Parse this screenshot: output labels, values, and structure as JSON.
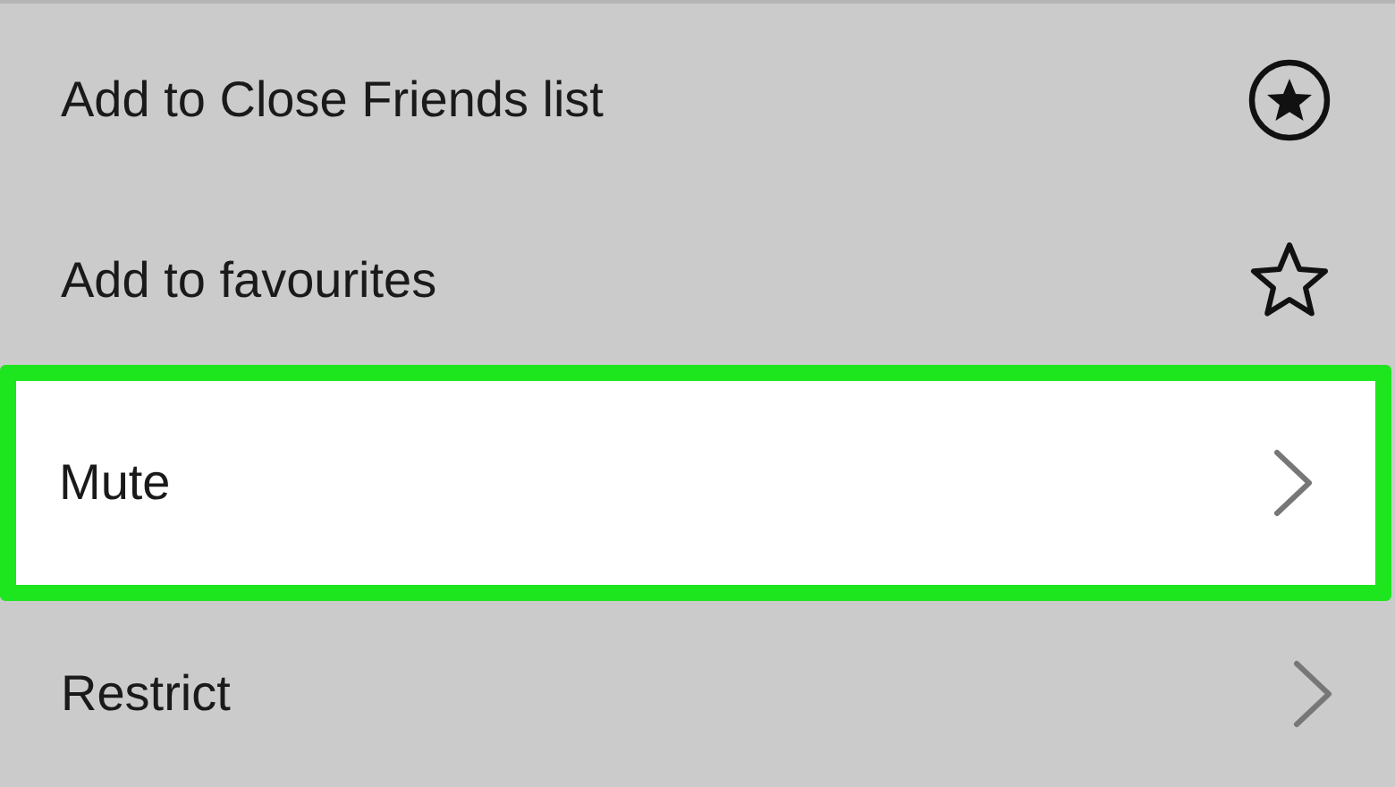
{
  "menu": {
    "items": [
      {
        "label": "Add to Close Friends list",
        "kind": "star-circle",
        "selected": false
      },
      {
        "label": "Add to favourites",
        "kind": "star",
        "selected": false
      },
      {
        "label": "Mute",
        "kind": "chevron",
        "selected": true
      },
      {
        "label": "Restrict",
        "kind": "chevron",
        "selected": false
      }
    ]
  }
}
